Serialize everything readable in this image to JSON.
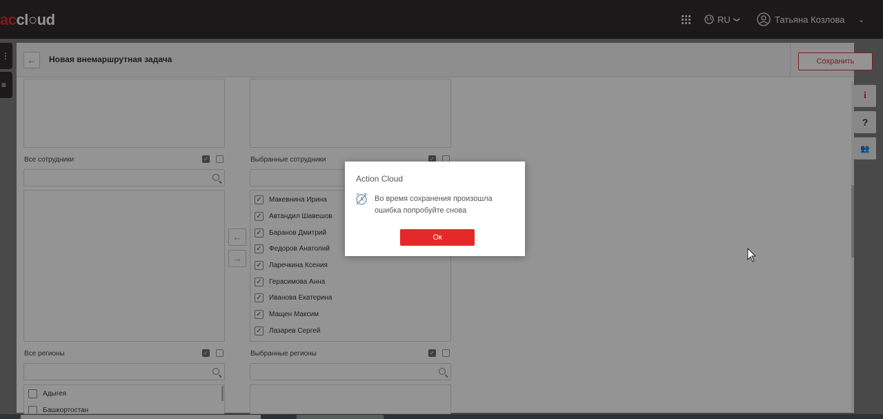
{
  "topbar": {
    "logo_prefix": "ac",
    "logo_main": "cl",
    "logo_suffix": "ud",
    "apps_icon": "grid-dots-icon",
    "language": "RU",
    "language_caret": "❯",
    "user_name": "Татьяна Козлова",
    "user_caret": "⌄"
  },
  "sidebar": {
    "tab1_icon": "⋮",
    "tab2_icon": "≡"
  },
  "header": {
    "back_icon": "←",
    "title": "Новая внемаршрутная задача",
    "save_label": "Сохранить"
  },
  "employees": {
    "all_label": "Все сотрудники",
    "selected_label": "Выбранные сотрудники",
    "selected_items": [
      "Макевнина Ирина",
      "Автандил Шавешов",
      "Баранов Дмитрий",
      "Федоров Анатолий",
      "Ларечкина Ксения",
      "Герасимова Анна",
      "Иванова Екатерина",
      "Мащен Максим",
      "Лазарев Сергей"
    ],
    "move_left": "←",
    "move_right": "→"
  },
  "regions": {
    "all_label": "Все регионы",
    "selected_label": "Выбранные регионы",
    "items": [
      "Адыгея",
      "Башкортостан"
    ]
  },
  "right_tools": {
    "info": "i",
    "help": "?",
    "users": "👥"
  },
  "modal": {
    "title": "Action Cloud",
    "message": "Во время сохранения произошла ошибка попробуйте снова",
    "ok_label": "Ок"
  },
  "colors": {
    "accent": "#e32a2a",
    "topbar": "#2f2c2c"
  }
}
